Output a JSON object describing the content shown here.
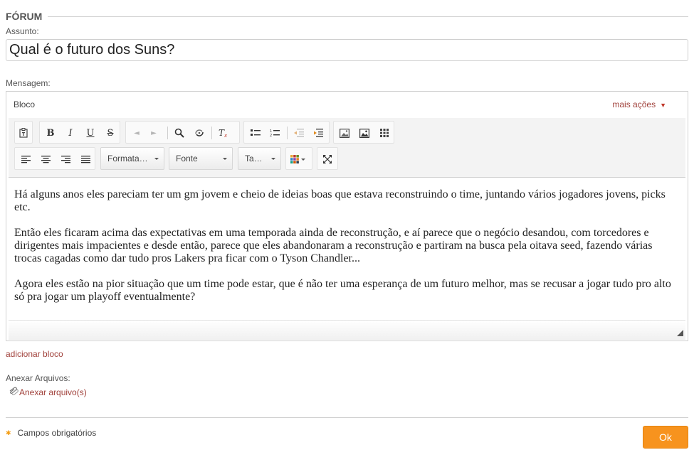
{
  "fieldset": {
    "legend": "FÓRUM"
  },
  "subject": {
    "label": "Assunto:",
    "value": "Qual é o futuro dos Suns?"
  },
  "message": {
    "label": "Mensagem:"
  },
  "editor": {
    "block_label": "Bloco",
    "more_actions": "mais ações",
    "toolbar": {
      "format_dropdown": "Formata…",
      "font_dropdown": "Fonte",
      "size_dropdown": "Ta…"
    },
    "paragraphs": [
      "Há alguns anos eles pareciam ter um gm jovem e cheio de ideias boas que estava reconstruindo o time, juntando vários jogadores jovens, picks etc.",
      "Então eles ficaram acima das expectativas em uma temporada ainda de reconstrução, e aí parece que o negócio desandou, com torcedores e dirigentes mais impacientes e desde então, parece que eles abandonaram a reconstrução e partiram na busca pela oitava seed, fazendo várias trocas cagadas como dar tudo pros Lakers pra ficar com o Tyson Chandler...",
      "Agora eles estão na pior situação que um time pode estar, que é não ter uma esperança de um futuro melhor, mas se recusar a jogar tudo pro alto só pra jogar um playoff eventualmente?"
    ]
  },
  "add_block": "adicionar bloco",
  "attachments": {
    "label": "Anexar Arquivos:",
    "link": "Anexar arquivo(s)"
  },
  "required_note": "Campos obrigatórios",
  "ok_button": "Ok",
  "colors": {
    "accent": "#f7931e",
    "link": "#a0403a"
  }
}
